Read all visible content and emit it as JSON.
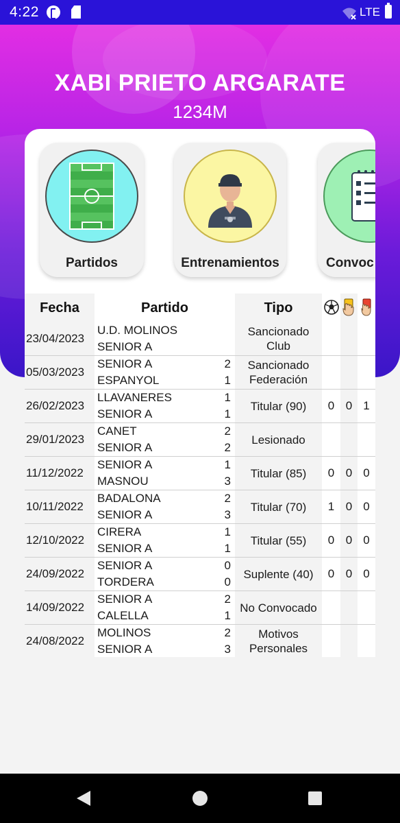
{
  "status_bar": {
    "time": "4:22",
    "network": "LTE"
  },
  "header": {
    "player_name": "XABI PRIETO ARGARATE",
    "player_id": "1234M"
  },
  "menu": [
    {
      "label": "Partidos",
      "icon": "soccer-field-icon"
    },
    {
      "label": "Entrenamientos",
      "icon": "coach-icon"
    },
    {
      "label": "Convoc",
      "icon": "checklist-icon"
    }
  ],
  "table": {
    "headers": {
      "fecha": "Fecha",
      "partido": "Partido",
      "tipo": "Tipo",
      "goles_icon": "soccer-ball-icon",
      "amarillas_icon": "yellow-card-icon",
      "rojas_icon": "red-card-icon"
    },
    "rows": [
      {
        "fecha": "23/04/2023",
        "home": "U.D. MOLINOS",
        "away": "SENIOR A",
        "home_score": "",
        "away_score": "",
        "tipo": "Sancionado Club",
        "goles": "",
        "amarillas": "",
        "rojas": ""
      },
      {
        "fecha": "05/03/2023",
        "home": "SENIOR A",
        "away": "ESPANYOL",
        "home_score": "2",
        "away_score": "1",
        "tipo": "Sancionado Federación",
        "goles": "",
        "amarillas": "",
        "rojas": ""
      },
      {
        "fecha": "26/02/2023",
        "home": "LLAVANERES",
        "away": "SENIOR A",
        "home_score": "1",
        "away_score": "1",
        "tipo": "Titular (90)",
        "goles": "0",
        "amarillas": "0",
        "rojas": "1"
      },
      {
        "fecha": "29/01/2023",
        "home": "CANET",
        "away": "SENIOR A",
        "home_score": "2",
        "away_score": "2",
        "tipo": "Lesionado",
        "goles": "",
        "amarillas": "",
        "rojas": ""
      },
      {
        "fecha": "11/12/2022",
        "home": "SENIOR A",
        "away": "MASNOU",
        "home_score": "1",
        "away_score": "3",
        "tipo": "Titular (85)",
        "goles": "0",
        "amarillas": "0",
        "rojas": "0"
      },
      {
        "fecha": "10/11/2022",
        "home": "BADALONA",
        "away": "SENIOR A",
        "home_score": "2",
        "away_score": "3",
        "tipo": "Titular (70)",
        "goles": "1",
        "amarillas": "0",
        "rojas": "0"
      },
      {
        "fecha": "12/10/2022",
        "home": "CIRERA",
        "away": "SENIOR A",
        "home_score": "1",
        "away_score": "1",
        "tipo": "Titular (55)",
        "goles": "0",
        "amarillas": "0",
        "rojas": "0"
      },
      {
        "fecha": "24/09/2022",
        "home": "SENIOR A",
        "away": "TORDERA",
        "home_score": "0",
        "away_score": "0",
        "tipo": "Suplente (40)",
        "goles": "0",
        "amarillas": "0",
        "rojas": "0"
      },
      {
        "fecha": "14/09/2022",
        "home": "SENIOR A",
        "away": "CALELLA",
        "home_score": "2",
        "away_score": "1",
        "tipo": "No Convocado",
        "goles": "",
        "amarillas": "",
        "rojas": ""
      },
      {
        "fecha": "24/08/2022",
        "home": "MOLINOS",
        "away": "SENIOR A",
        "home_score": "2",
        "away_score": "3",
        "tipo": "Motivos Personales",
        "goles": "",
        "amarillas": "",
        "rojas": ""
      }
    ]
  },
  "colors": {
    "status_bar": "#2a13d8",
    "header_top": "#e22ee3",
    "header_bottom": "#3a16c8",
    "partidos_circle": "#82f1f1",
    "entrenamientos_circle": "#fbf6a3",
    "convocatorias_circle": "#9ef0b4"
  }
}
